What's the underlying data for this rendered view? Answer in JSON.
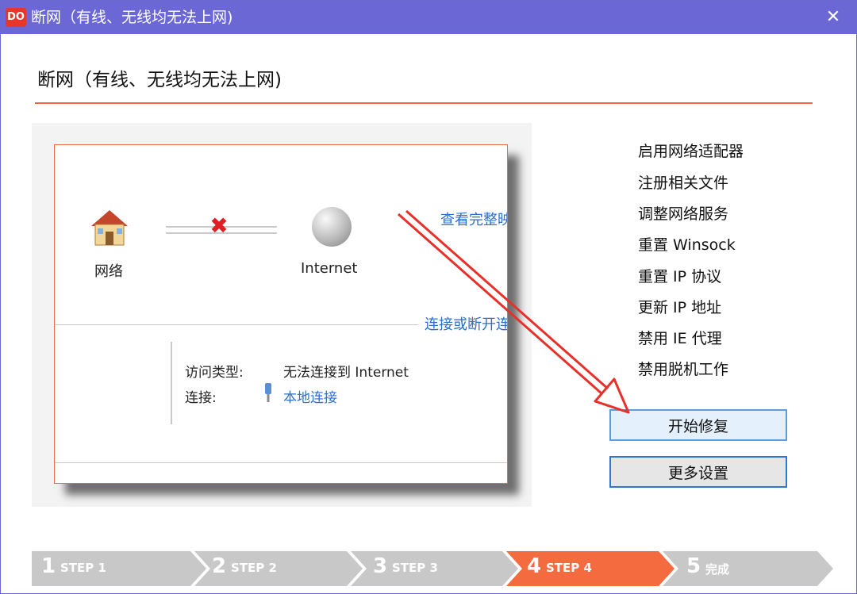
{
  "window": {
    "title": "断网（有线、无线均无法上网)",
    "app_icon_text": "DO",
    "close_glyph": "✕"
  },
  "heading": "断网（有线、无线均无法上网)",
  "network_view": {
    "network_label": "网络",
    "internet_label": "Internet",
    "view_full_link": "查看完整映",
    "connect_link": "连接或断开连",
    "access_type_label": "访问类型:",
    "access_type_value": "无法连接到 Internet",
    "connection_label": "连接:",
    "connection_value": "本地连接"
  },
  "actions": [
    "启用网络适配器",
    "注册相关文件",
    "调整网络服务",
    "重置 Winsock",
    "重置 IP 协议",
    "更新 IP 地址",
    "禁用 IE 代理",
    "禁用脱机工作"
  ],
  "buttons": {
    "start_repair": "开始修复",
    "more_settings": "更多设置"
  },
  "steps": [
    {
      "num": "1",
      "label": "STEP 1"
    },
    {
      "num": "2",
      "label": "STEP 2"
    },
    {
      "num": "3",
      "label": "STEP 3"
    },
    {
      "num": "4",
      "label": "STEP 4"
    },
    {
      "num": "5",
      "label": "完成"
    }
  ],
  "colors": {
    "titlebar": "#6b68d6",
    "accent": "#f0693f",
    "active_step": "#f56b40",
    "inactive_step": "#c8c8c8",
    "link": "#2a6fd0",
    "arrow": "#e8302a"
  },
  "current_step": 4
}
